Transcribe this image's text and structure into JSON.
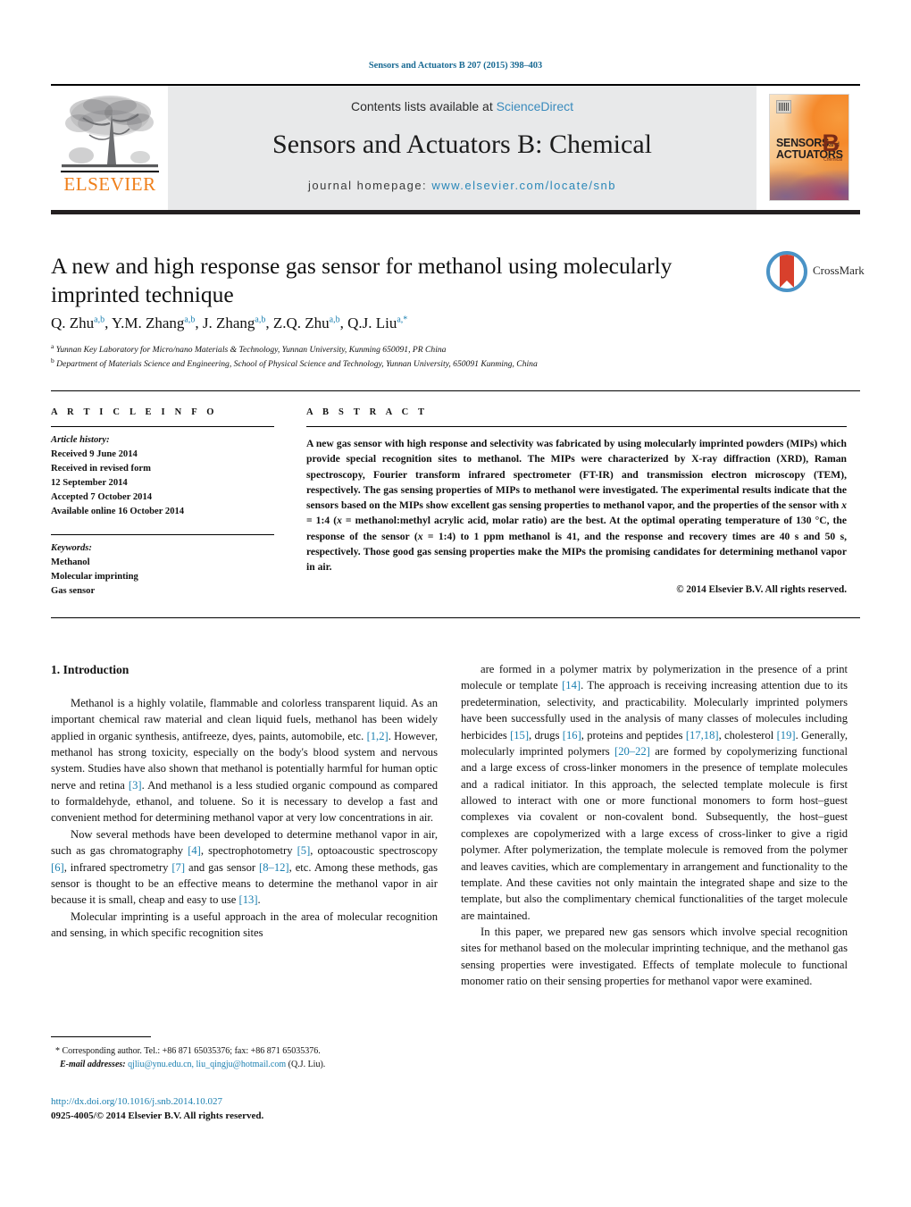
{
  "running_head": "Sensors and Actuators B 207 (2015) 398–403",
  "masthead": {
    "contents_prefix": "Contents lists available at ",
    "contents_link": "ScienceDirect",
    "journal_title": "Sensors and Actuators B: Chemical",
    "homepage_label": "journal homepage:",
    "homepage_url": "www.elsevier.com/locate/snb",
    "publisher_logo_text": "ELSEVIER",
    "cover": {
      "line1": "SENSORS",
      "line1_small": "and",
      "line2": "ACTUATORS",
      "letter": "B",
      "letter_sub": "Chemical"
    }
  },
  "article": {
    "title": "A new and high response gas sensor for methanol using molecularly imprinted technique",
    "crossmark_label": "CrossMark",
    "authors": [
      {
        "name": "Q. Zhu",
        "sup": "a,b"
      },
      {
        "name": "Y.M. Zhang",
        "sup": "a,b"
      },
      {
        "name": "J. Zhang",
        "sup": "a,b"
      },
      {
        "name": "Z.Q. Zhu",
        "sup": "a,b"
      },
      {
        "name": "Q.J. Liu",
        "sup": "a,*"
      }
    ],
    "affiliations": [
      {
        "marker": "a",
        "text": "Yunnan Key Laboratory for Micro/nano Materials & Technology, Yunnan University, Kunming 650091, PR China"
      },
      {
        "marker": "b",
        "text": "Department of Materials Science and Engineering, School of Physical Science and Technology, Yunnan University, 650091 Kunming, China"
      }
    ]
  },
  "article_info": {
    "heading": "A R T I C L E   I N F O",
    "history_label": "Article history:",
    "history": [
      "Received 9 June 2014",
      "Received in revised form",
      "12 September 2014",
      "Accepted 7 October 2014",
      "Available online 16 October 2014"
    ],
    "keywords_label": "Keywords:",
    "keywords": [
      "Methanol",
      "Molecular imprinting",
      "Gas sensor"
    ]
  },
  "abstract": {
    "heading": "A B S T R A C T",
    "text_part1": "A new gas sensor with high response and selectivity was fabricated by using molecularly imprinted powders (MIPs) which provide special recognition sites to methanol. The MIPs were characterized by X-ray diffraction (XRD), Raman spectroscopy, Fourier transform infrared spectrometer (FT-IR) and transmission electron microscopy (TEM), respectively. The gas sensing properties of MIPs to methanol were investigated. The experimental results indicate that the sensors based on the MIPs show excellent gas sensing properties to methanol vapor, and the properties of the sensor with ",
    "x_italic_1": "x",
    "text_part2": " = 1:4 (",
    "x_italic_2": "x",
    "text_part3": " = methanol:methyl acrylic acid, molar ratio) are the best. At the optimal operating temperature of 130 °C, the response of the sensor (",
    "x_italic_3": "x",
    "text_part4": " = 1:4) to 1 ppm methanol is 41, and the response and recovery times are 40 s and 50 s, respectively. Those good gas sensing properties make the MIPs the promising candidates for determining methanol vapor in air.",
    "copyright": "© 2014 Elsevier B.V. All rights reserved."
  },
  "body": {
    "section_number_title": "1.  Introduction",
    "left_paragraphs": [
      "Methanol is a highly volatile, flammable and colorless transparent liquid. As an important chemical raw material and clean liquid fuels, methanol has been widely applied in organic synthesis, antifreeze, dyes, paints, automobile, etc. [1,2]. However, methanol has strong toxicity, especially on the body's blood system and nervous system. Studies have also shown that methanol is potentially harmful for human optic nerve and retina [3]. And methanol is a less studied organic compound as compared to formaldehyde, ethanol, and toluene. So it is necessary to develop a fast and convenient method for determining methanol vapor at very low concentrations in air.",
      "Now several methods have been developed to determine methanol vapor in air, such as gas chromatography [4], spectrophotometry [5], optoacoustic spectroscopy [6], infrared spectrometry [7] and gas sensor [8–12], etc. Among these methods, gas sensor is thought to be an effective means to determine the methanol vapor in air because it is small, cheap and easy to use [13].",
      "Molecular imprinting is a useful approach in the area of molecular recognition and sensing, in which specific recognition sites"
    ],
    "right_paragraphs": [
      "are formed in a polymer matrix by polymerization in the presence of a print molecule or template [14]. The approach is receiving increasing attention due to its predetermination, selectivity, and practicability. Molecularly imprinted polymers have been successfully used in the analysis of many classes of molecules including herbicides [15], drugs [16], proteins and peptides [17,18], cholesterol [19]. Generally, molecularly imprinted polymers [20–22] are formed by copolymerizing functional and a large excess of cross-linker monomers in the presence of template molecules and a radical initiator. In this approach, the selected template molecule is first allowed to interact with one or more functional monomers to form host–guest complexes via covalent or non-covalent bond. Subsequently, the host–guest complexes are copolymerized with a large excess of cross-linker to give a rigid polymer. After polymerization, the template molecule is removed from the polymer and leaves cavities, which are complementary in arrangement and functionality to the template. And these cavities not only maintain the integrated shape and size to the template, but also the complimentary chemical functionalities of the target molecule are maintained.",
      "In this paper, we prepared new gas sensors which involve special recognition sites for methanol based on the molecular imprinting technique, and the methanol gas sensing properties were investigated. Effects of template molecule to functional monomer ratio on their sensing properties for methanol vapor were examined."
    ]
  },
  "footer": {
    "corresponding_marker": "*",
    "corresponding_text": "Corresponding author. Tel.: +86 871 65035376; fax: +86 871 65035376.",
    "email_label": "E-mail addresses:",
    "emails": "qjliu@ynu.edu.cn, liu_qingju@hotmail.com",
    "email_suffix": " (Q.J. Liu).",
    "doi_url": "http://dx.doi.org/10.1016/j.snb.2014.10.027",
    "issn_line": "0925-4005/© 2014 Elsevier B.V. All rights reserved."
  },
  "colors": {
    "link": "#1a7fb0",
    "masthead_bg": "#e8e9ea",
    "elsevier_orange": "#ef7f1a",
    "crossmark_blue": "#4a93c6",
    "crossmark_red": "#d8402c"
  }
}
